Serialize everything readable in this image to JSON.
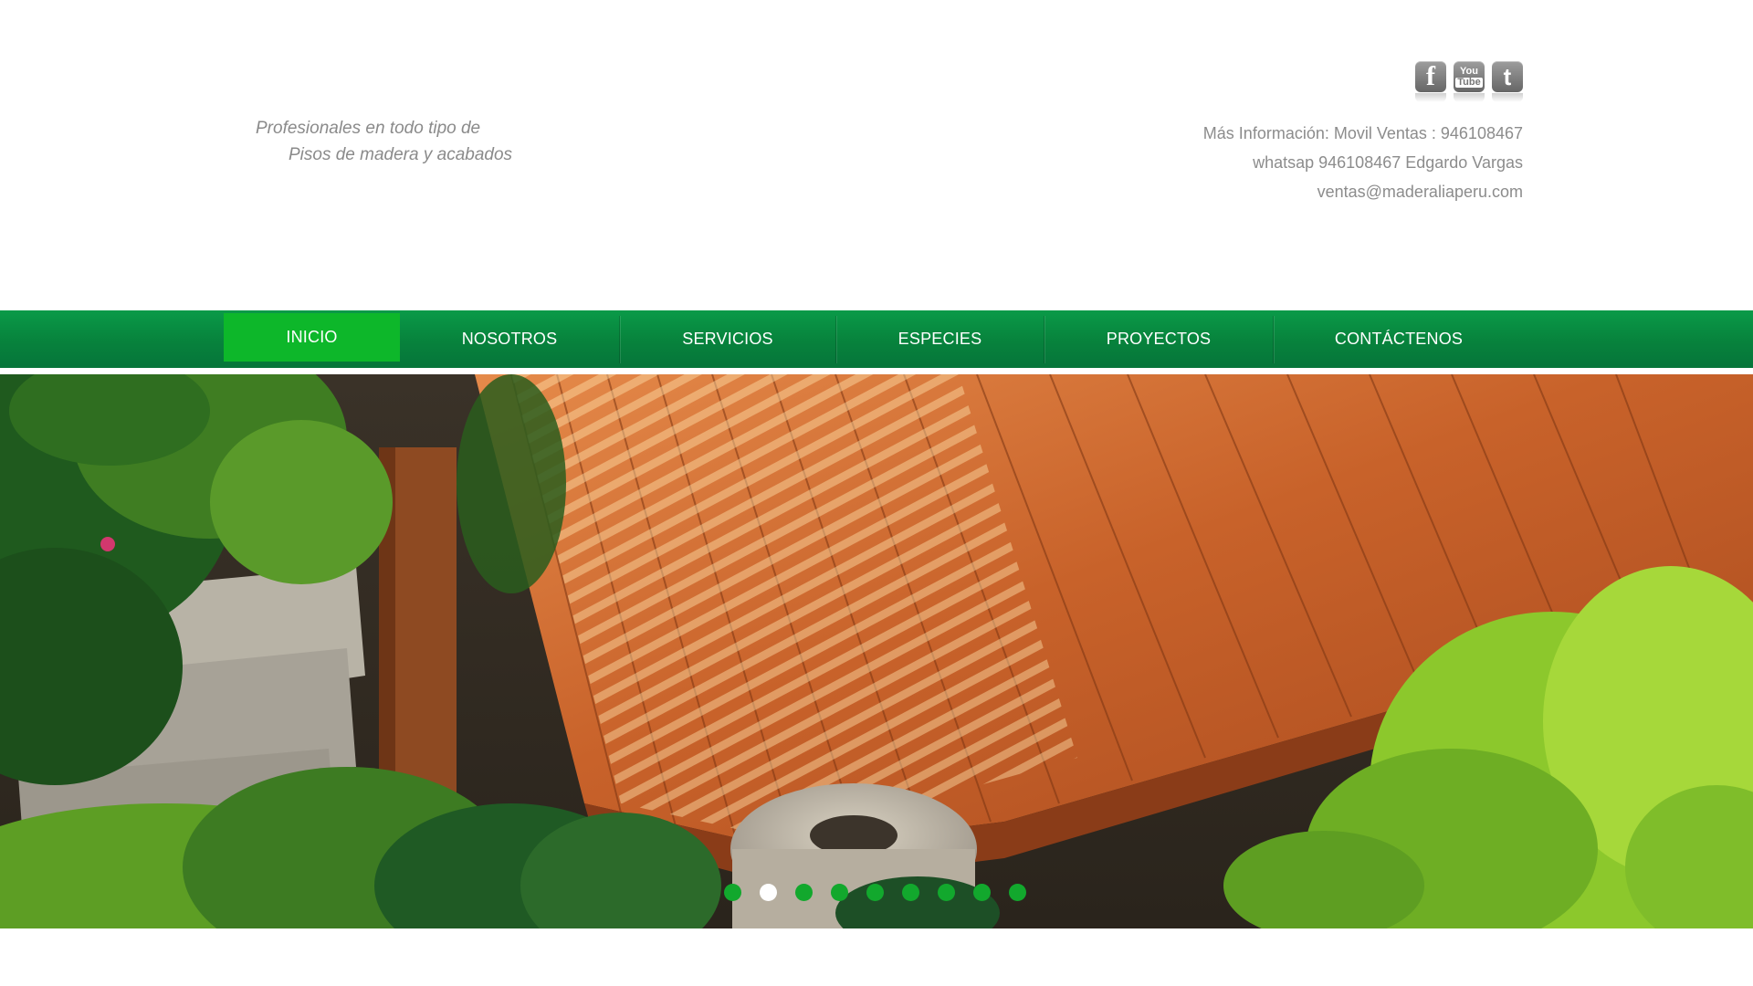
{
  "header": {
    "tagline_line1": "Profesionales en todo tipo de",
    "tagline_line2": "Pisos de madera y acabados",
    "contact": {
      "line1": "Más Información: Movil Ventas : 946108467",
      "line2": "whatsap 946108467 Edgardo Vargas",
      "line3": "ventas@maderaliaperu.com"
    },
    "social": [
      {
        "icon": "facebook-icon",
        "glyph": "f"
      },
      {
        "icon": "youtube-icon",
        "glyph_you": "You",
        "glyph_tube": "Tube"
      },
      {
        "icon": "twitter-icon",
        "glyph": "t"
      }
    ]
  },
  "nav": {
    "items": [
      {
        "label": "INICIO",
        "active": true
      },
      {
        "label": "NOSOTROS",
        "active": false
      },
      {
        "label": "SERVICIOS",
        "active": false
      },
      {
        "label": "ESPECIES",
        "active": false
      },
      {
        "label": "PROYECTOS",
        "active": false
      },
      {
        "label": "CONTÁCTENOS",
        "active": false
      }
    ]
  },
  "slider": {
    "image": "wooden-deck-garden-photo",
    "slide_count": 9,
    "active_slide": 2
  },
  "colors": {
    "nav_green": "#07823c",
    "nav_active": "#0db72a",
    "dot_green": "#12a82d",
    "text_gray": "#8c8c8c"
  }
}
